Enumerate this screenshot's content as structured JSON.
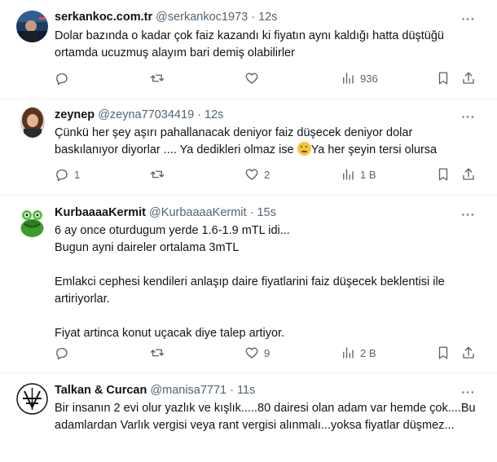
{
  "tweets": [
    {
      "name": "serkankoc.com.tr",
      "handle": "@serkankoc1973",
      "dot": "·",
      "time": "12s",
      "text": "Dolar bazında o kadar çok faiz kazandı ki fiyatın aynı kaldığı hatta düştüğü ortamda ucuzmuş alayım bari demiş olabilirler",
      "replies": "",
      "retweets": "",
      "likes": "",
      "views": "936"
    },
    {
      "name": "zeynep",
      "handle": "@zeyna77034419",
      "dot": "·",
      "time": "12s",
      "text_before_emoji": "Çünkü her şey aşırı pahallanacak deniyor  faiz düşecek deniyor dolar baskılanıyor diyorlar .... Ya dedikleri olmaz ise ",
      "emoji_icon": "thinking-face-emoji",
      "text_after_emoji": "Ya her şeyin  tersi olursa",
      "replies": "1",
      "retweets": "",
      "likes": "2",
      "views": "1 B"
    },
    {
      "name": "KurbaaaaKermit",
      "handle": "@KurbaaaaKermit",
      "dot": "·",
      "time": "15s",
      "text": "6 ay once oturdugum yerde 1.6-1.9 mTL idi...\nBugun ayni daireler ortalama 3mTL\n\nEmlakci cephesi kendileri anlaşıp daire fiyatlarini faiz düşecek beklentisi ile artiriyorlar.\n\nFiyat artinca konut uçacak diye talep artiyor.",
      "replies": "",
      "retweets": "",
      "likes": "9",
      "views": "2 B"
    },
    {
      "name": "Talkan & Curcan",
      "handle": "@manisa7771",
      "dot": "·",
      "time": "11s",
      "text": "Bir insanın 2 evi olur yazlık ve kışlık.....80 dairesi olan adam var hemde çok....Bu adamlardan Varlık vergisi veya rant vergisi alınmalı...yoksa fiyatlar düşmez..."
    }
  ],
  "icons": {
    "more": "more-horizontal-icon",
    "reply": "reply-icon",
    "retweet": "retweet-icon",
    "like": "heart-icon",
    "views": "views-chart-icon",
    "bookmark": "bookmark-icon",
    "share": "share-icon"
  },
  "colors": {
    "text": "#0f1419",
    "secondary": "#536471",
    "divider": "#eff3f4"
  }
}
